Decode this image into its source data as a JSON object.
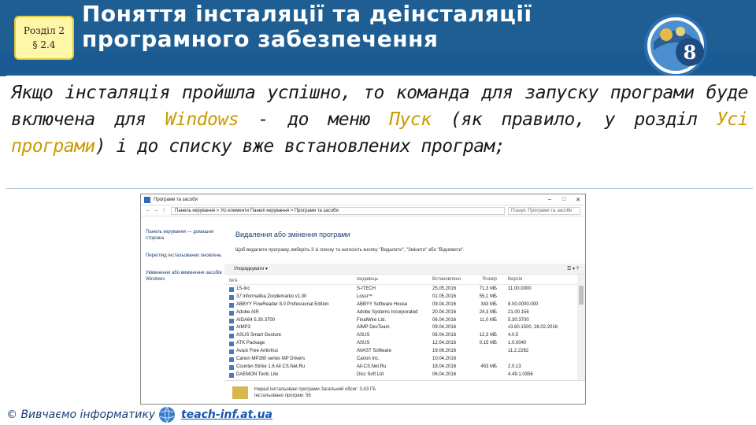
{
  "header": {
    "badge": {
      "line1": "Розділ 2",
      "line2": "§ 2.4"
    },
    "title_line1": "Поняття інсталяції та деінсталяції",
    "title_line2": "програмного забезпечення",
    "logo_number": "8"
  },
  "body_text": {
    "part1": "Якщо інсталяція пройшла успішно, то команда для запуску програми буде включена для ",
    "windows": "Windows",
    "part2": " - до меню ",
    "pusk": "Пуск",
    "part3": " (як правило, у розділ ",
    "all_programs": "Усі програми",
    "part4": ") і до списку вже встановлених програм;"
  },
  "window": {
    "title": "Програми та засоби",
    "address": "Панель керування  >  Усі елементи Панелі керування  >  Програми та засоби",
    "search_placeholder": "Пошук: Програми та засоби",
    "left_links": [
      "Панель керування — домашня сторінка",
      "Перегляд інстальованих оновлень",
      "Увімкнення або вимкнення засобів Windows"
    ],
    "heading": "Видалення або змінення програми",
    "subheading": "Щоб видалити програму, виберіть її зі списку та натисніть кнопку \"Видалити\", \"Змінити\" або \"Відновити\".",
    "toolbar_label": "Упорядкувати ▾",
    "columns": [
      "Ім'я",
      "Видавець",
      "Встановлено",
      "Розмір",
      "Версія"
    ],
    "rows": [
      [
        "1S-Inc",
        "S-ITECH",
        "25.05.2016",
        "71,3 МБ",
        "11.00.0000"
      ],
      [
        "37 informatika Zoodemarko v1.00",
        "Lossi™",
        "01.05.2016",
        "55,1 МБ",
        ""
      ],
      [
        "ABBYY FineReader 8.0 Professional Edition",
        "ABBYY Software House",
        "09.04.2016",
        "343 МБ",
        "8.00.0000.000"
      ],
      [
        "Adobe AIR",
        "Adobe Systems Incorporated",
        "20.04.2016",
        "24,3 МБ",
        "21.00.156"
      ],
      [
        "AIDA64 5.30.3700",
        "FinalWire Ltd.",
        "06.04.2016",
        "11,0 МБ",
        "5.30.3700"
      ],
      [
        "AIMP3",
        "AIMP DevTeam",
        "09.04.2016",
        "",
        "v3.60.1500, 28.02.2016"
      ],
      [
        "ASUS Smart Gesture",
        "ASUS",
        "06.04.2016",
        "12,3 МБ",
        "4.0.5"
      ],
      [
        "ATK Package",
        "ASUS",
        "12.04.2016",
        "0,15 МБ",
        "1.0.0040"
      ],
      [
        "Avast Free Antivirus",
        "AVAST Software",
        "19.06.2016",
        "",
        "11.2.2262"
      ],
      [
        "Canon MP280 series MP Drivers",
        "Canon Inc.",
        "10.04.2016",
        "",
        ""
      ],
      [
        "Counter-Strike 1.6 All CS.Net.Ru",
        "All-CS.Net.Ru",
        "18.04.2016",
        "453 МБ",
        "2.0.13"
      ],
      [
        "DAEMON Tools Lite",
        "Disc Soft Ltd",
        "06.04.2016",
        "",
        "4.49.1.0356"
      ]
    ],
    "status_line1": "Наразі інстальовані програми   Загальний обсяг: 3,43 ГБ",
    "status_line2": "Інстальовано програм: 58"
  },
  "footer": {
    "copyright": "© Вивчаємо інформатику",
    "site": "teach-inf.at.ua"
  }
}
